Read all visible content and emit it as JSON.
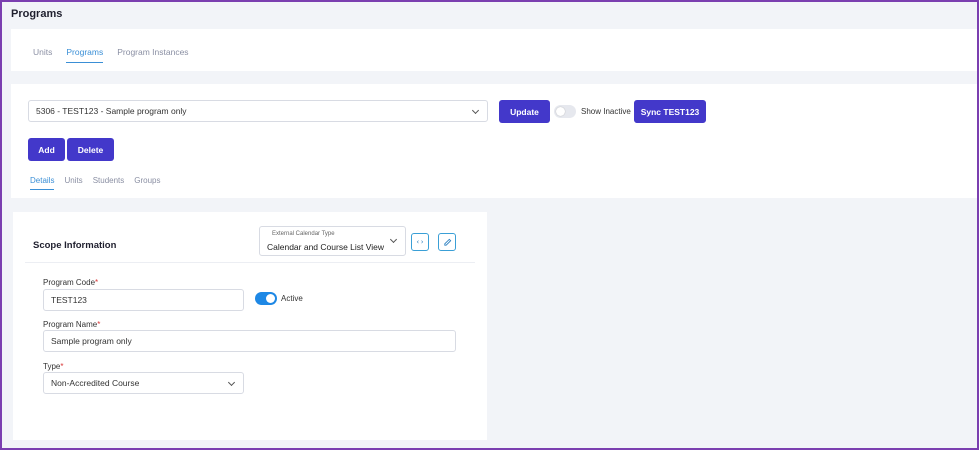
{
  "page": {
    "title": "Programs"
  },
  "top_tabs": [
    {
      "label": "Units",
      "active": false
    },
    {
      "label": "Programs",
      "active": true
    },
    {
      "label": "Program Instances",
      "active": false
    }
  ],
  "program_selector": {
    "value": "5306 - TEST123 - Sample program only"
  },
  "toolbar": {
    "update_label": "Update",
    "show_inactive_label": "Show Inactive",
    "show_inactive_on": false,
    "sync_label": "Sync TEST123",
    "add_label": "Add",
    "delete_label": "Delete"
  },
  "sub_tabs": [
    {
      "label": "Details",
      "active": true
    },
    {
      "label": "Units",
      "active": false
    },
    {
      "label": "Students",
      "active": false
    },
    {
      "label": "Groups",
      "active": false
    }
  ],
  "scope": {
    "title": "Scope Information",
    "external_calendar": {
      "label": "External Calendar Type",
      "value": "Calendar and Course List View"
    },
    "icons": [
      "code-icon",
      "edit-icon"
    ]
  },
  "form": {
    "program_code": {
      "label": "Program Code",
      "required_mark": "*",
      "value": "TEST123"
    },
    "active": {
      "label": "Active",
      "on": true
    },
    "program_name": {
      "label": "Program Name",
      "required_mark": "*",
      "value": "Sample program only"
    },
    "type": {
      "label": "Type",
      "required_mark": "*",
      "value": "Non-Accredited Course"
    }
  },
  "colors": {
    "primary_button": "#4338ca",
    "active_tab": "#3a8fd6",
    "toggle_on": "#1e88e5",
    "frame_border": "#7b3fb0"
  }
}
